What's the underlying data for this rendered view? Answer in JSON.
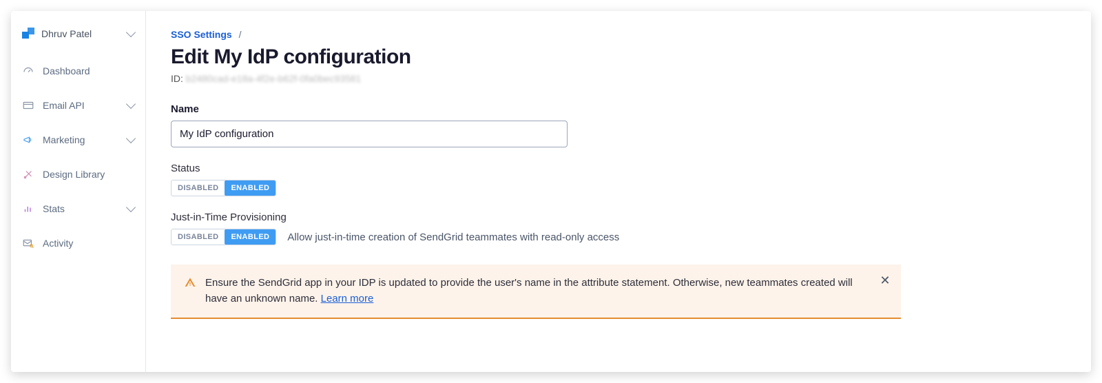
{
  "sidebar": {
    "user": "Dhruv Patel",
    "items": [
      {
        "label": "Dashboard",
        "icon": "gauge",
        "expandable": false
      },
      {
        "label": "Email API",
        "icon": "card",
        "expandable": true
      },
      {
        "label": "Marketing",
        "icon": "megaphone",
        "expandable": true
      },
      {
        "label": "Design Library",
        "icon": "swatch",
        "expandable": false
      },
      {
        "label": "Stats",
        "icon": "bars",
        "expandable": true
      },
      {
        "label": "Activity",
        "icon": "envelope",
        "expandable": false
      }
    ]
  },
  "breadcrumb": {
    "parent": "SSO Settings",
    "sep": "/"
  },
  "page": {
    "title": "Edit My IdP configuration",
    "id_prefix": "ID: ",
    "id_value": "b2480cad-e18a-4f2e-b62f-0fa0bec93581"
  },
  "form": {
    "name_label": "Name",
    "name_value": "My IdP configuration",
    "status_label": "Status",
    "status_options": {
      "off": "DISABLED",
      "on": "ENABLED"
    },
    "status_value": "ENABLED",
    "jit_label": "Just-in-Time Provisioning",
    "jit_options": {
      "off": "DISABLED",
      "on": "ENABLED"
    },
    "jit_value": "ENABLED",
    "jit_description": "Allow just-in-time creation of SendGrid teammates with read-only access"
  },
  "alert": {
    "text_before_link": "Ensure the SendGrid app in your IDP is updated to provide the user's name in the attribute statement. Otherwise, new teammates created will have an unknown name. ",
    "link_text": "Learn more"
  }
}
